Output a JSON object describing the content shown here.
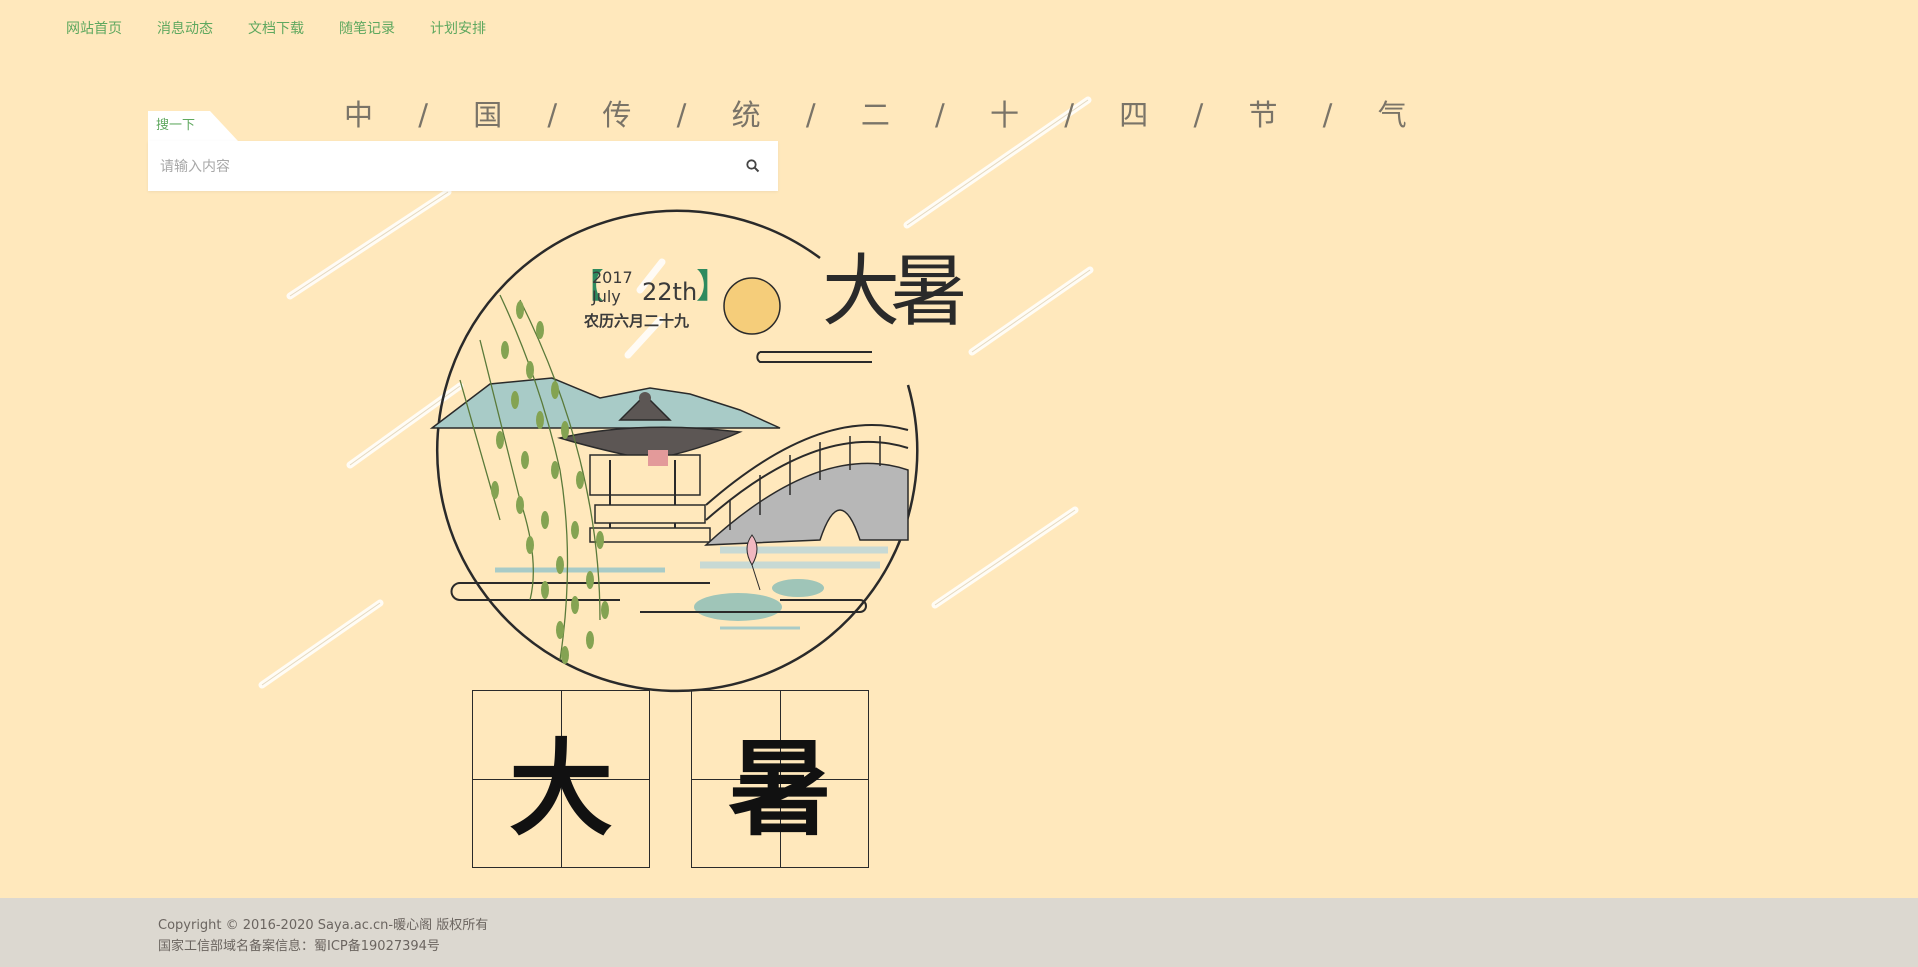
{
  "nav": {
    "items": [
      {
        "label": "网站首页"
      },
      {
        "label": "消息动态"
      },
      {
        "label": "文档下载"
      },
      {
        "label": "随笔记录"
      },
      {
        "label": "计划安排"
      }
    ]
  },
  "search": {
    "tab_label": "搜一下",
    "placeholder": "请输入内容",
    "button_icon": "search-icon"
  },
  "page_title": "中 / 国 / 传 / 统 / 二 / 十 / 四 / 节 / 气",
  "illustration": {
    "year": "2017",
    "month": "July",
    "day": "22th",
    "lunar_date": "农历六月二十九",
    "solar_term_calligraphy": "大暑"
  },
  "solar_term_chars": [
    "大",
    "暑"
  ],
  "footer": {
    "copyright": "Copyright © 2016-2020   Saya.ac.cn-暖心阁 版权所有",
    "icp": "国家工信部域名备案信息：蜀ICP备19027394号"
  },
  "colors": {
    "background": "#ffe8bc",
    "nav_text": "#5fa85f",
    "footer_bg": "#dcd8d0",
    "moon": "#f5cd7a",
    "bracket": "#2e8a5e"
  }
}
